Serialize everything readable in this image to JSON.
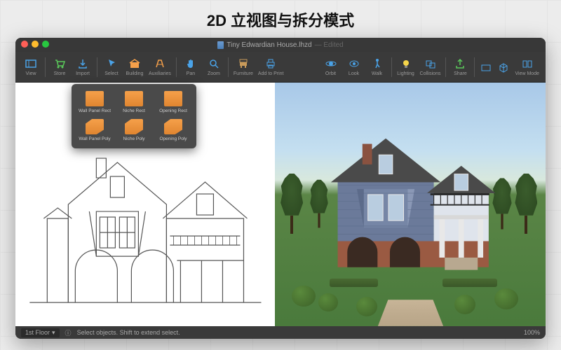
{
  "header": {
    "title": "2D 立视图与拆分模式"
  },
  "titlebar": {
    "filename": "Tiny Edwardian House.lhzd",
    "state": "Edited"
  },
  "toolbar": {
    "left": [
      {
        "id": "view",
        "label": "View",
        "color": "#4aa3e8"
      }
    ],
    "group2": [
      {
        "id": "store",
        "label": "Store",
        "color": "#5ac85a"
      },
      {
        "id": "import",
        "label": "Import",
        "color": "#4aa3e8"
      }
    ],
    "group3": [
      {
        "id": "select",
        "label": "Select",
        "color": "#4aa3e8"
      },
      {
        "id": "building",
        "label": "Building",
        "color": "#f5a04a"
      },
      {
        "id": "auxiliaries",
        "label": "Auxiliaries",
        "color": "#f5a04a"
      }
    ],
    "group4": [
      {
        "id": "pan",
        "label": "Pan",
        "color": "#4aa3e8"
      },
      {
        "id": "zoom",
        "label": "Zoom",
        "color": "#4aa3e8"
      }
    ],
    "group5": [
      {
        "id": "furniture",
        "label": "Furniture",
        "color": "#c89a5a"
      },
      {
        "id": "addtoprint",
        "label": "Add to Print",
        "color": "#4aa3e8"
      }
    ],
    "r1": [
      {
        "id": "orbit",
        "label": "Orbit",
        "color": "#4aa3e8"
      },
      {
        "id": "look",
        "label": "Look",
        "color": "#4aa3e8"
      },
      {
        "id": "walk",
        "label": "Walk",
        "color": "#4aa3e8"
      }
    ],
    "r2": [
      {
        "id": "lighting",
        "label": "Lighting",
        "color": "#f5d54a"
      },
      {
        "id": "collisions",
        "label": "Collisions",
        "color": "#4aa3e8"
      }
    ],
    "r3": [
      {
        "id": "share",
        "label": "Share",
        "color": "#5ac85a"
      }
    ],
    "r4": [
      {
        "id": "2d",
        "label": "",
        "color": "#4aa3e8"
      },
      {
        "id": "3d",
        "label": "",
        "color": "#4aa3e8"
      },
      {
        "id": "viewmode",
        "label": "View Mode",
        "color": "#4aa3e8"
      }
    ]
  },
  "popover": {
    "row1": [
      {
        "label": "Wall Panel Rect",
        "shape": "rect"
      },
      {
        "label": "Niche Rect",
        "shape": "rect"
      },
      {
        "label": "Opening Rect",
        "shape": "rect"
      }
    ],
    "row2": [
      {
        "label": "Wall Panel Poly",
        "shape": "poly"
      },
      {
        "label": "Niche Poly",
        "shape": "poly"
      },
      {
        "label": "Opening Poly",
        "shape": "poly"
      }
    ]
  },
  "statusbar": {
    "floor": "1st Floor",
    "hint": "Select objects. Shift to extend select.",
    "zoom": "100%"
  }
}
